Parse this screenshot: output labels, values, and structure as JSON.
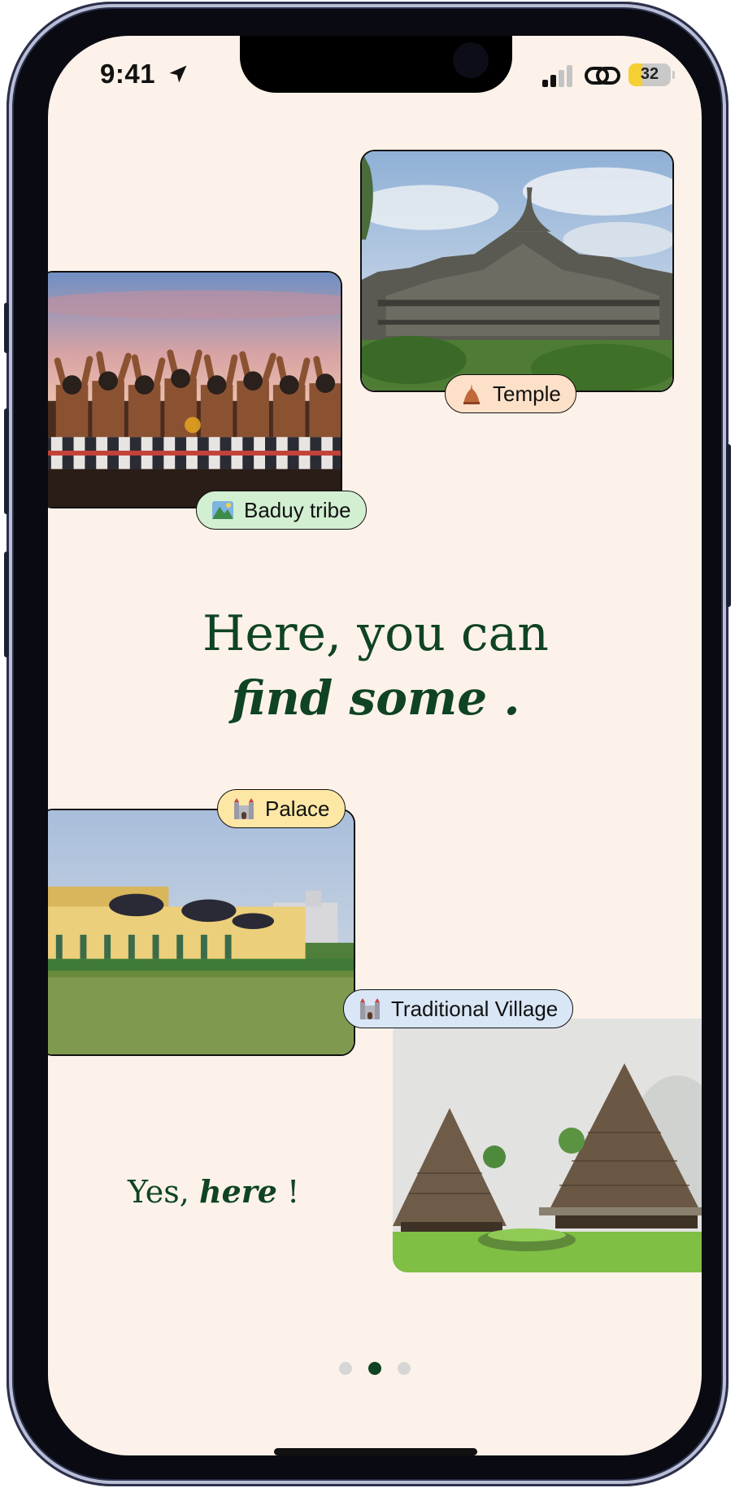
{
  "status_bar": {
    "time": "9:41",
    "battery_level": "32",
    "battery_fraction": 0.32
  },
  "cards": [
    {
      "name": "Temple",
      "emoji": "stupa-emoji",
      "pill_color": "#fde0c8"
    },
    {
      "name": "Baduy tribe",
      "emoji": "landscape-photo-emoji",
      "pill_color": "#d3efd2"
    },
    {
      "name": "Palace",
      "emoji": "castle-emoji",
      "pill_color": "#fde7a4"
    },
    {
      "name": "Traditional Village",
      "emoji": "castle-emoji",
      "pill_color": "#d8e6f6"
    }
  ],
  "headline": {
    "line1": "Here, you can",
    "line2": "find some ."
  },
  "tagline": {
    "prefix": "Yes, ",
    "emphasis": "here",
    "suffix": " !"
  },
  "pager": {
    "count": 3,
    "active_index": 1
  },
  "colors": {
    "background": "#fcf2e9",
    "text_green": "#0f4324",
    "dot_inactive": "#d6d6d6"
  }
}
